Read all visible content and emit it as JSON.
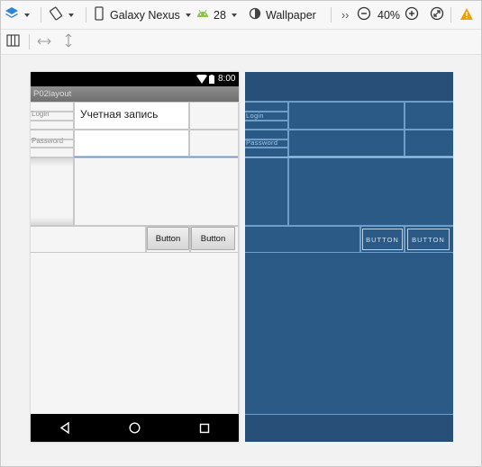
{
  "toolbar": {
    "device": "Galaxy Nexus",
    "api_level": "28",
    "theme": "Wallpaper",
    "overflow": "››",
    "zoom": "40%"
  },
  "phone": {
    "status_time": "8:00",
    "app_title": "P02layout",
    "login_label": "Login",
    "password_label": "Password",
    "account_field_value": "Учетная запись",
    "button1": "Button",
    "button2": "Button"
  },
  "blueprint": {
    "login_label": "Login",
    "password_label": "Password",
    "button1": "BUTTON",
    "button2": "BUTTON"
  },
  "colors": {
    "blueprint_bg": "#2c5a86",
    "warning": "#f0a000",
    "android_green": "#8bc34a"
  }
}
